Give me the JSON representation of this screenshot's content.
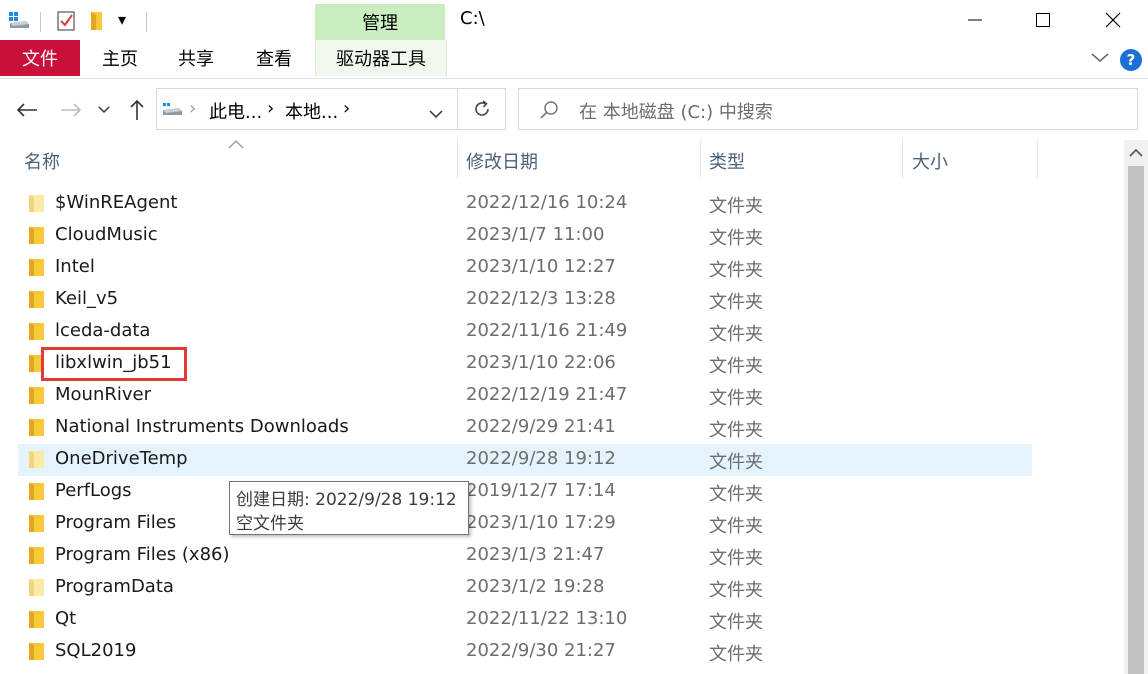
{
  "window": {
    "title": "C:\\",
    "minimize_glyph": "—",
    "maximize_glyph": "☐",
    "close_glyph": "✕"
  },
  "quick_access": {
    "dropdown_glyph": "▾"
  },
  "ribbon": {
    "context_group": "管理",
    "tabs": {
      "file": "文件",
      "home": "主页",
      "share": "共享",
      "view": "查看",
      "drive_tools": "驱动器工具"
    },
    "help_glyph": "?",
    "collapse_glyph": "⌵",
    "accent": "#c8103a",
    "context_color": "#cbeec0"
  },
  "nav": {
    "back_glyph": "←",
    "forward_glyph": "→",
    "recent_glyph": "⌄",
    "up_glyph": "↑",
    "breadcrumb": [
      "此电...",
      "本地..."
    ],
    "crumb_sep": "›",
    "dropdown_glyph": "⌄",
    "refresh_glyph": "↻",
    "search_placeholder": "在 本地磁盘 (C:) 中搜索"
  },
  "columns": {
    "name": "名称",
    "modified": "修改日期",
    "type": "类型",
    "size": "大小",
    "sort_glyph": "⌃"
  },
  "files": [
    {
      "name": "$WinREAgent",
      "modified": "2022/12/16 10:24",
      "type": "文件夹"
    },
    {
      "name": "CloudMusic",
      "modified": "2023/1/7 11:00",
      "type": "文件夹"
    },
    {
      "name": "Intel",
      "modified": "2023/1/10 12:27",
      "type": "文件夹"
    },
    {
      "name": "Keil_v5",
      "modified": "2022/12/3 13:28",
      "type": "文件夹"
    },
    {
      "name": "lceda-data",
      "modified": "2022/11/16 21:49",
      "type": "文件夹"
    },
    {
      "name": "libxlwin_jb51",
      "modified": "2023/1/10 22:06",
      "type": "文件夹"
    },
    {
      "name": "MounRiver",
      "modified": "2022/12/19 21:47",
      "type": "文件夹"
    },
    {
      "name": "National Instruments Downloads",
      "modified": "2022/9/29 21:41",
      "type": "文件夹"
    },
    {
      "name": "OneDriveTemp",
      "modified": "2022/9/28 19:12",
      "type": "文件夹"
    },
    {
      "name": "PerfLogs",
      "modified": "2019/12/7 17:14",
      "type": "文件夹"
    },
    {
      "name": "Program Files",
      "modified": "2023/1/10 17:29",
      "type": "文件夹"
    },
    {
      "name": "Program Files (x86)",
      "modified": "2023/1/3 21:47",
      "type": "文件夹"
    },
    {
      "name": "ProgramData",
      "modified": "2023/1/2 19:28",
      "type": "文件夹"
    },
    {
      "name": "Qt",
      "modified": "2022/11/22 13:10",
      "type": "文件夹"
    },
    {
      "name": "SQL2019",
      "modified": "2022/9/30 21:27",
      "type": "文件夹"
    }
  ],
  "tooltip": {
    "line1": "创建日期: 2022/9/28 19:12",
    "line2": "空文件夹"
  },
  "scrollbar": {
    "up_glyph": "▲"
  },
  "colors": {
    "folder": "#f8c93b",
    "folder_light": "#fde9a6",
    "hover": "#e5f3ff",
    "highlight_box": "#e53935"
  }
}
